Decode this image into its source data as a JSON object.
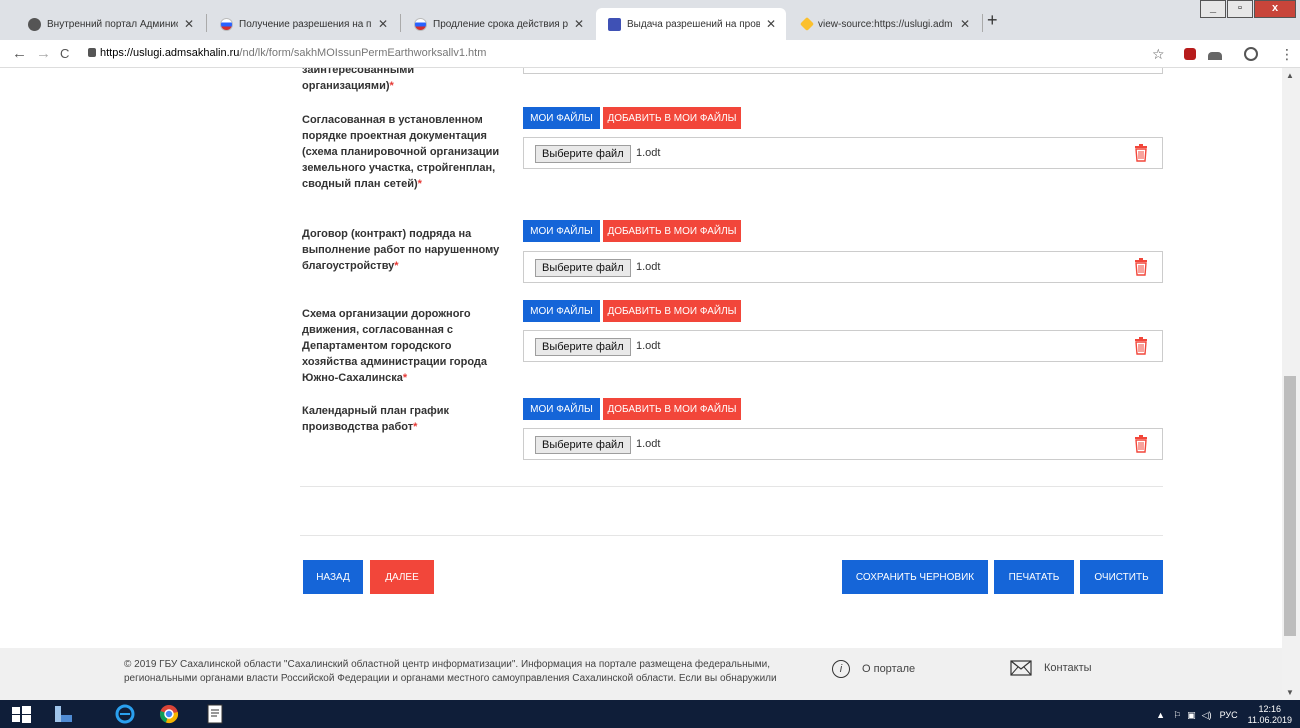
{
  "browser": {
    "tabs": [
      {
        "title": "Внутренний портал Администр",
        "fav_color": "#555555"
      },
      {
        "title": "Получение разрешения на про",
        "fav_color": "#d32f2f"
      },
      {
        "title": "Продление срока действия раз",
        "fav_color": "#d32f2f"
      },
      {
        "title": "Выдача разрешений на провед",
        "fav_color": "#3f51b5"
      },
      {
        "title": "view-source:https://uslugi.adm",
        "fav_color": "#fbc02d"
      }
    ],
    "tab_close": "✕",
    "new_tab": "+",
    "window_buttons": {
      "minimize": "_",
      "maximize": "▫",
      "close": "x"
    },
    "url_host": "https://uslugi.admsakhalin.ru",
    "url_path": "/nd/lk/form/sakhMOIssunPermEarthworksallv1.htm"
  },
  "form": {
    "top_label_tail": "заинтересованными организациями)",
    "required_mark": "*",
    "my_files_label": "МОИ ФАЙЛЫ",
    "add_to_my_files_label": "ДОБАВИТЬ В МОИ ФАЙЛЫ",
    "choose_file_label": "Выберите файл",
    "fields": [
      {
        "label": "Согласованная в установленном порядке проектная документация (схема планировочной организации земельного участка, стройгенплан, сводный план сетей)",
        "file": "1.odt"
      },
      {
        "label": "Договор (контракт) подряда на выполнение работ по нарушенному благоустройству",
        "file": "1.odt"
      },
      {
        "label": "Схема организации дорожного движения, согласованная с Департаментом городского хозяйства администрации города Южно-Сахалинска",
        "file": "1.odt"
      },
      {
        "label": "Календарный план график производства работ",
        "file": "1.odt"
      }
    ]
  },
  "actions": {
    "back": "НАЗАД",
    "next": "ДАЛЕЕ",
    "save_draft": "СОХРАНИТЬ ЧЕРНОВИК",
    "print": "ПЕЧАТАТЬ",
    "clear": "ОЧИСТИТЬ"
  },
  "footer": {
    "text": "© 2019 ГБУ Сахалинской области \"Сахалинский областной центр информатизации\". Информация на портале размещена федеральными, региональными органами власти Российской Федерации и органами местного самоуправления Сахалинской области. Если вы обнаружили",
    "about": "О портале",
    "contacts": "Контакты",
    "info_glyph": "i"
  },
  "taskbar": {
    "lang": "РУС",
    "time": "12:16",
    "date": "11.06.2019"
  },
  "colors": {
    "blue": "#1565d8",
    "red": "#f2463a"
  }
}
